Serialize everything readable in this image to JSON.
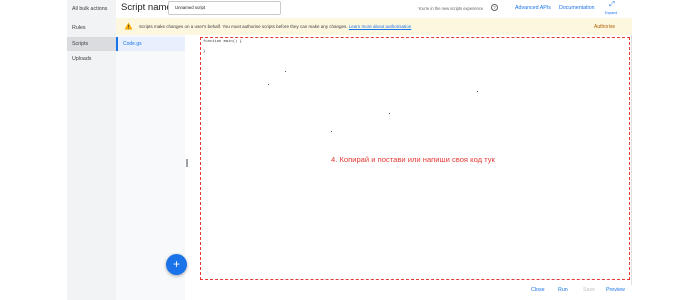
{
  "sidebar": {
    "items": [
      {
        "label": "All bulk actions",
        "active": false
      },
      {
        "label": "Rules",
        "active": false
      },
      {
        "label": "Scripts",
        "active": true
      },
      {
        "label": "Uploads",
        "active": false
      }
    ]
  },
  "header": {
    "title": "Script name:",
    "script_name_value": "Unnamed script",
    "experience_text": "You're in the new scripts experience",
    "help_icon": "help-icon",
    "advanced_apis": "Advanced APIs",
    "documentation": "Documentation",
    "expand_label": "Expand",
    "expand_icon": "expand-icon"
  },
  "banner": {
    "icon": "warning-icon",
    "text": "Scripts make changes on a user's behalf. You must authorise scripts before they can make any changes.",
    "link": "Learn more about authorisation",
    "action": "Authorise"
  },
  "files": {
    "items": [
      "Code.gs"
    ],
    "add_button": "+"
  },
  "editor": {
    "code_lines": [
      "function main() {",
      "",
      "}"
    ],
    "annotation": "4. Копирай и постави или напиши своя код тук"
  },
  "footer": {
    "close": "Close",
    "run": "Run",
    "save": "Save",
    "preview": "Preview"
  },
  "colors": {
    "accent": "#1a73e8",
    "banner_bg": "#fef7e0",
    "annotation": "#e53935"
  }
}
